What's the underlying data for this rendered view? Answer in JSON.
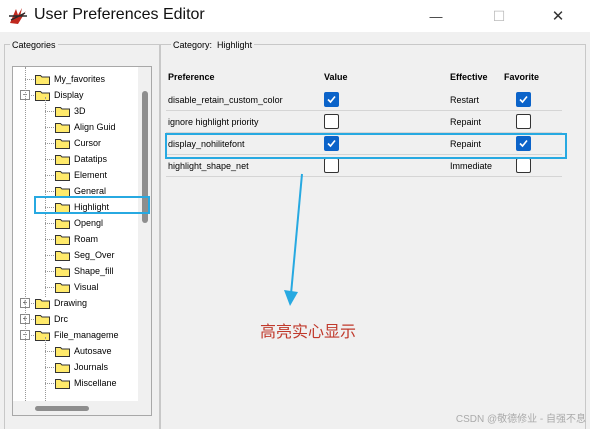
{
  "window": {
    "title": "User Preferences Editor",
    "controls": {
      "minimize": "—",
      "maximize": "☐",
      "close": "✕"
    }
  },
  "categories": {
    "label": "Categories",
    "items": [
      {
        "label": "My_favorites",
        "level": 1,
        "expander": ""
      },
      {
        "label": "Display",
        "level": 1,
        "expander": "−"
      },
      {
        "label": "3D",
        "level": 2,
        "expander": ""
      },
      {
        "label": "Align Guid",
        "level": 2,
        "expander": ""
      },
      {
        "label": "Cursor",
        "level": 2,
        "expander": ""
      },
      {
        "label": "Datatips",
        "level": 2,
        "expander": ""
      },
      {
        "label": "Element",
        "level": 2,
        "expander": ""
      },
      {
        "label": "General",
        "level": 2,
        "expander": ""
      },
      {
        "label": "Highlight",
        "level": 2,
        "expander": "",
        "selected": true
      },
      {
        "label": "Opengl",
        "level": 2,
        "expander": ""
      },
      {
        "label": "Roam",
        "level": 2,
        "expander": ""
      },
      {
        "label": "Seg_Over",
        "level": 2,
        "expander": ""
      },
      {
        "label": "Shape_fill",
        "level": 2,
        "expander": ""
      },
      {
        "label": "Visual",
        "level": 2,
        "expander": ""
      },
      {
        "label": "Drawing",
        "level": 1,
        "expander": "+"
      },
      {
        "label": "Drc",
        "level": 1,
        "expander": "+"
      },
      {
        "label": "File_manageme",
        "level": 1,
        "expander": "−"
      },
      {
        "label": "Autosave",
        "level": 2,
        "expander": ""
      },
      {
        "label": "Journals",
        "level": 2,
        "expander": ""
      },
      {
        "label": "Miscellane",
        "level": 2,
        "expander": ""
      }
    ]
  },
  "main": {
    "category_prefix": "Category:",
    "category_name": "Highlight",
    "columns": {
      "preference": "Preference",
      "value": "Value",
      "effective": "Effective",
      "favorite": "Favorite"
    },
    "rows": [
      {
        "preference": "disable_retain_custom_color",
        "value": true,
        "effective": "Restart",
        "favorite": true
      },
      {
        "preference": "ignore highlight priority",
        "value": false,
        "effective": "Repaint",
        "favorite": false
      },
      {
        "preference": "display_nohilitefont",
        "value": true,
        "effective": "Repaint",
        "favorite": true
      },
      {
        "preference": "highlight_shape_net",
        "value": false,
        "effective": "Immediate",
        "favorite": false
      }
    ]
  },
  "annotation": {
    "text": "高亮实心显示",
    "color": "#c0392b"
  },
  "watermark": "CSDN @敬德修业 - 自强不息",
  "colors": {
    "check_blue": "#0b63c9",
    "highlight_box": "#27a9e1"
  }
}
